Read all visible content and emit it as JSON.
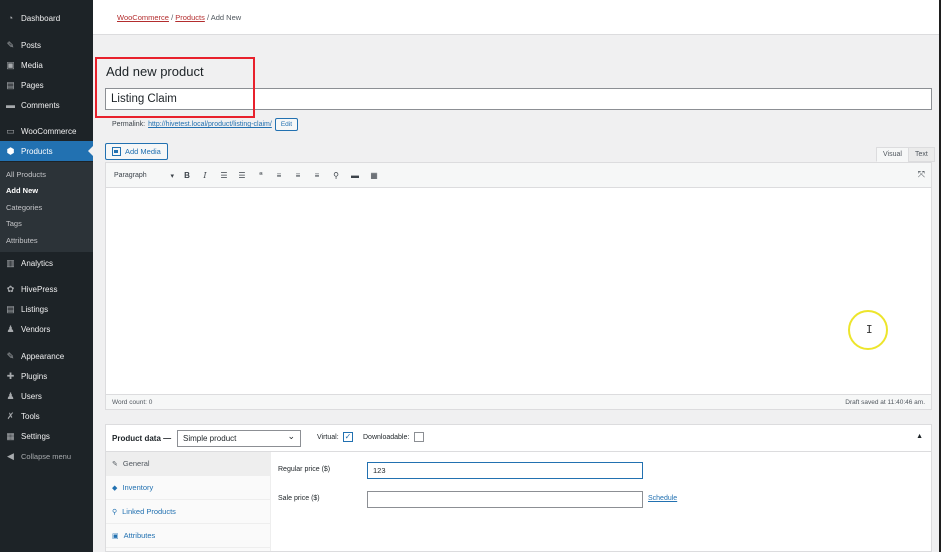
{
  "sidebar": {
    "items": [
      {
        "label": "Dashboard",
        "icon": "dashboard-icon",
        "glyph": "◔"
      },
      {
        "label": "Posts",
        "icon": "pin-icon",
        "glyph": "✎"
      },
      {
        "label": "Media",
        "icon": "media-icon",
        "glyph": "▣"
      },
      {
        "label": "Pages",
        "icon": "pages-icon",
        "glyph": "▤"
      },
      {
        "label": "Comments",
        "icon": "comments-icon",
        "glyph": "▬"
      },
      {
        "label": "WooCommerce",
        "icon": "woo-icon",
        "glyph": "▭"
      },
      {
        "label": "Products",
        "icon": "products-icon",
        "glyph": "⬢"
      },
      {
        "label": "Analytics",
        "icon": "analytics-icon",
        "glyph": "▥"
      },
      {
        "label": "HivePress",
        "icon": "hivepress-icon",
        "glyph": "✿"
      },
      {
        "label": "Listings",
        "icon": "listings-icon",
        "glyph": "▤"
      },
      {
        "label": "Vendors",
        "icon": "vendors-icon",
        "glyph": "♟"
      },
      {
        "label": "Appearance",
        "icon": "appearance-icon",
        "glyph": "✎"
      },
      {
        "label": "Plugins",
        "icon": "plugins-icon",
        "glyph": "✚"
      },
      {
        "label": "Users",
        "icon": "users-icon",
        "glyph": "♟"
      },
      {
        "label": "Tools",
        "icon": "tools-icon",
        "glyph": "✗"
      },
      {
        "label": "Settings",
        "icon": "settings-icon",
        "glyph": "▦"
      },
      {
        "label": "Collapse menu",
        "icon": "collapse-icon",
        "glyph": "◀"
      }
    ],
    "submenu": [
      "All Products",
      "Add New",
      "Categories",
      "Tags",
      "Attributes"
    ]
  },
  "breadcrumb": {
    "woocommerce": "WooCommerce",
    "sep1": "/",
    "products": "Products",
    "sep2": "/",
    "current": "Add New"
  },
  "page": {
    "title": "Add new product",
    "product_title_value": "Listing Claim",
    "permalink_label": "Permalink:",
    "permalink_url": "http://hivetest.local/product/listing-claim/",
    "edit_label": "Edit"
  },
  "editor": {
    "add_media_label": "Add Media",
    "tab_visual": "Visual",
    "tab_text": "Text",
    "format": "Paragraph",
    "toolbar_icons": [
      "bold-icon",
      "italic-icon",
      "bullet-list-icon",
      "numbered-list-icon",
      "blockquote-icon",
      "align-left-icon",
      "align-center-icon",
      "align-right-icon",
      "link-icon",
      "read-more-icon",
      "toolbar-toggle-icon"
    ],
    "word_count": "Word count: 0",
    "draft_saved": "Draft saved at 11:40:46 am."
  },
  "product_data": {
    "label": "Product data —",
    "type": "Simple product",
    "virtual_label": "Virtual:",
    "virtual_checked": true,
    "downloadable_label": "Downloadable:",
    "downloadable_checked": false,
    "tabs": [
      {
        "label": "General",
        "icon": "wrench-icon"
      },
      {
        "label": "Inventory",
        "icon": "tag-icon"
      },
      {
        "label": "Linked Products",
        "icon": "link-icon"
      },
      {
        "label": "Attributes",
        "icon": "grid-icon"
      }
    ],
    "regular_price_label": "Regular price ($)",
    "regular_price_value": "123",
    "sale_price_label": "Sale price ($)",
    "sale_price_value": "",
    "schedule_label": "Schedule"
  },
  "colors": {
    "sidebar_bg": "#1d2327",
    "accent": "#2271b1",
    "highlight_box": "#e8212c",
    "cursor_ring": "#ede52b"
  }
}
